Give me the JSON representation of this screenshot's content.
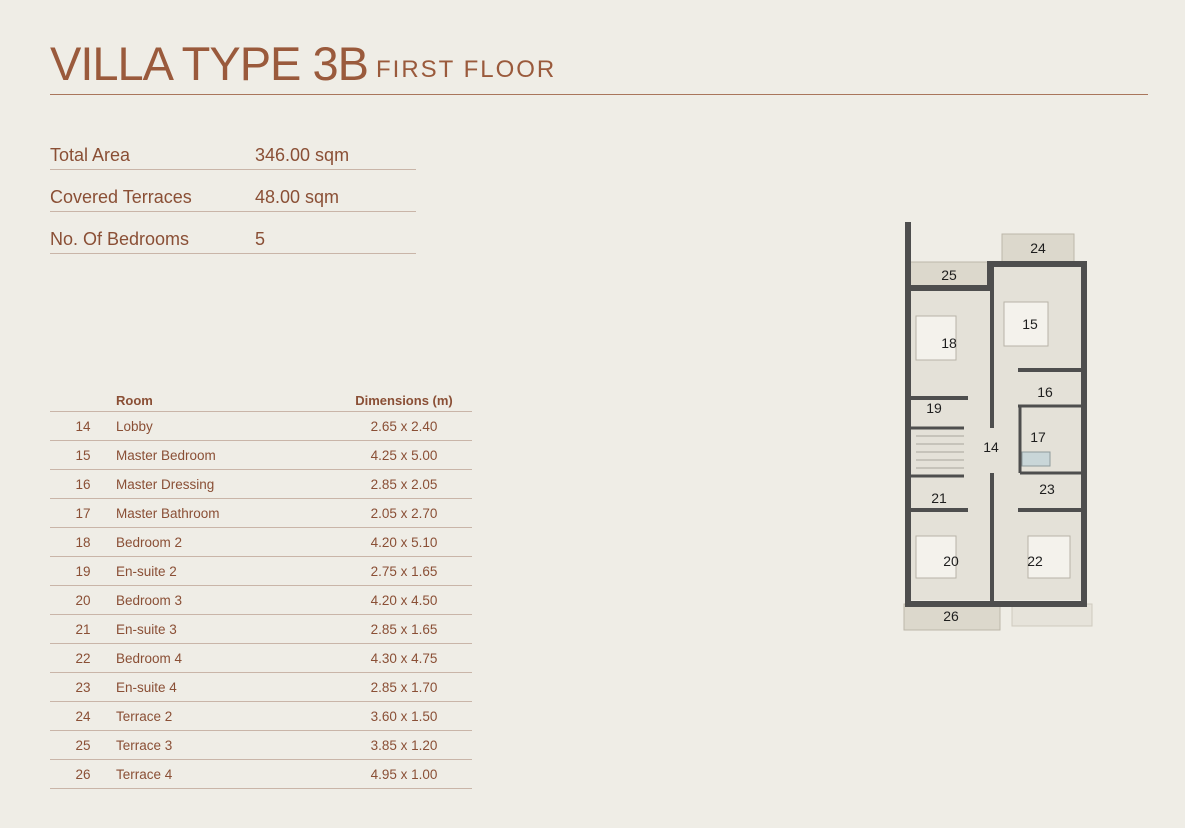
{
  "header": {
    "title": "VILLA TYPE 3B",
    "subtitle": "FIRST FLOOR"
  },
  "summary": [
    {
      "label": "Total Area",
      "value": "346.00 sqm"
    },
    {
      "label": "Covered Terraces",
      "value": "48.00 sqm"
    },
    {
      "label": "No. Of Bedrooms",
      "value": "5"
    }
  ],
  "room_table": {
    "headers": [
      "",
      "Room",
      "Dimensions (m)"
    ],
    "rows": [
      {
        "num": "14",
        "room": "Lobby",
        "dims": "2.65 x 2.40"
      },
      {
        "num": "15",
        "room": "Master Bedroom",
        "dims": "4.25 x 5.00"
      },
      {
        "num": "16",
        "room": "Master Dressing",
        "dims": "2.85 x 2.05"
      },
      {
        "num": "17",
        "room": "Master Bathroom",
        "dims": "2.05 x 2.70"
      },
      {
        "num": "18",
        "room": "Bedroom 2",
        "dims": "4.20 x 5.10"
      },
      {
        "num": "19",
        "room": "En-suite 2",
        "dims": "2.75 x 1.65"
      },
      {
        "num": "20",
        "room": "Bedroom 3",
        "dims": "4.20 x 4.50"
      },
      {
        "num": "21",
        "room": "En-suite 3",
        "dims": "2.85 x 1.65"
      },
      {
        "num": "22",
        "room": "Bedroom 4",
        "dims": "4.30 x 4.75"
      },
      {
        "num": "23",
        "room": "En-suite 4",
        "dims": "2.85 x 1.70"
      },
      {
        "num": "24",
        "room": "Terrace 2",
        "dims": "3.60 x 1.50"
      },
      {
        "num": "25",
        "room": "Terrace 3",
        "dims": "3.85 x 1.20"
      },
      {
        "num": "26",
        "room": "Terrace 4",
        "dims": "4.95 x 1.00"
      }
    ]
  },
  "floor_plan": {
    "labels": [
      "24",
      "25",
      "15",
      "18",
      "16",
      "19",
      "14",
      "17",
      "23",
      "21",
      "20",
      "22",
      "26"
    ]
  },
  "colors": {
    "accent": "#9a5a3c",
    "text": "#8a4f35",
    "rule": "#c9b5a8",
    "background": "#efede6",
    "wall": "#4e4e4e"
  }
}
